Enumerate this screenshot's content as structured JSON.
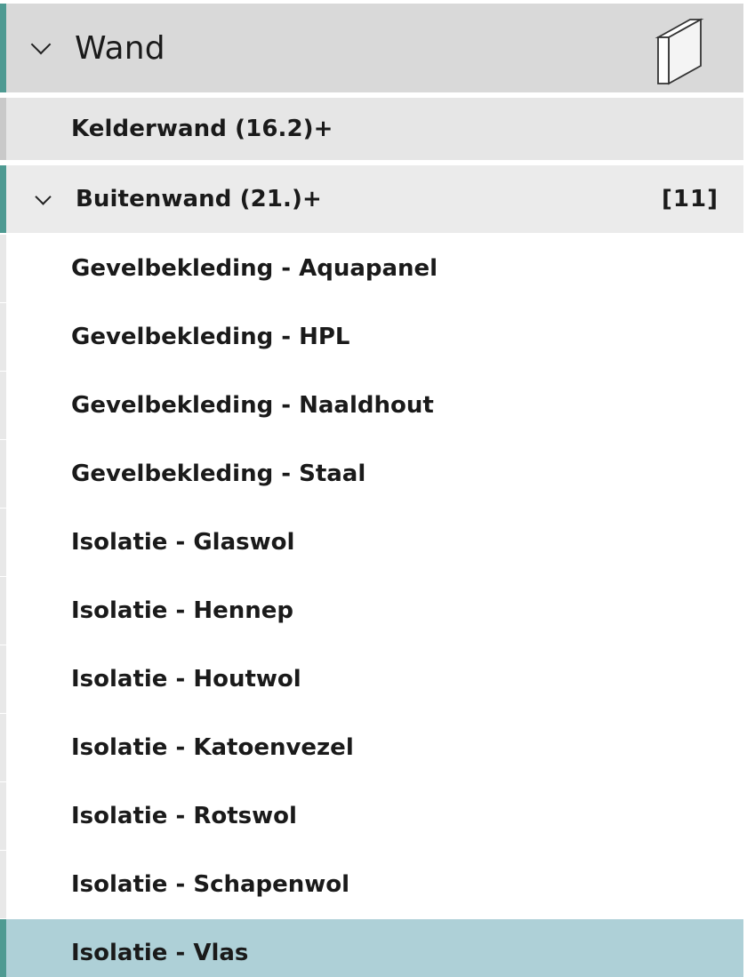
{
  "category": {
    "title": "Wand",
    "icon": "wall-panel-icon",
    "accent_color": "#4e9a92"
  },
  "groups": [
    {
      "label": "Kelderwand (16.2)+",
      "expanded": false
    },
    {
      "label": "Buitenwand (21.)+",
      "expanded": true,
      "count": "[11]"
    }
  ],
  "items": [
    "Gevelbekleding - Aquapanel",
    "Gevelbekleding - HPL",
    "Gevelbekleding - Naaldhout",
    "Gevelbekleding - Staal",
    "Isolatie - Glaswol",
    "Isolatie - Hennep",
    "Isolatie - Houtwol",
    "Isolatie - Katoenvezel",
    "Isolatie - Rotswol",
    "Isolatie - Schapenwol",
    "Isolatie - Vlas"
  ],
  "selected_item": "Isolatie - Vlas",
  "selected_color": "#aed0d7"
}
